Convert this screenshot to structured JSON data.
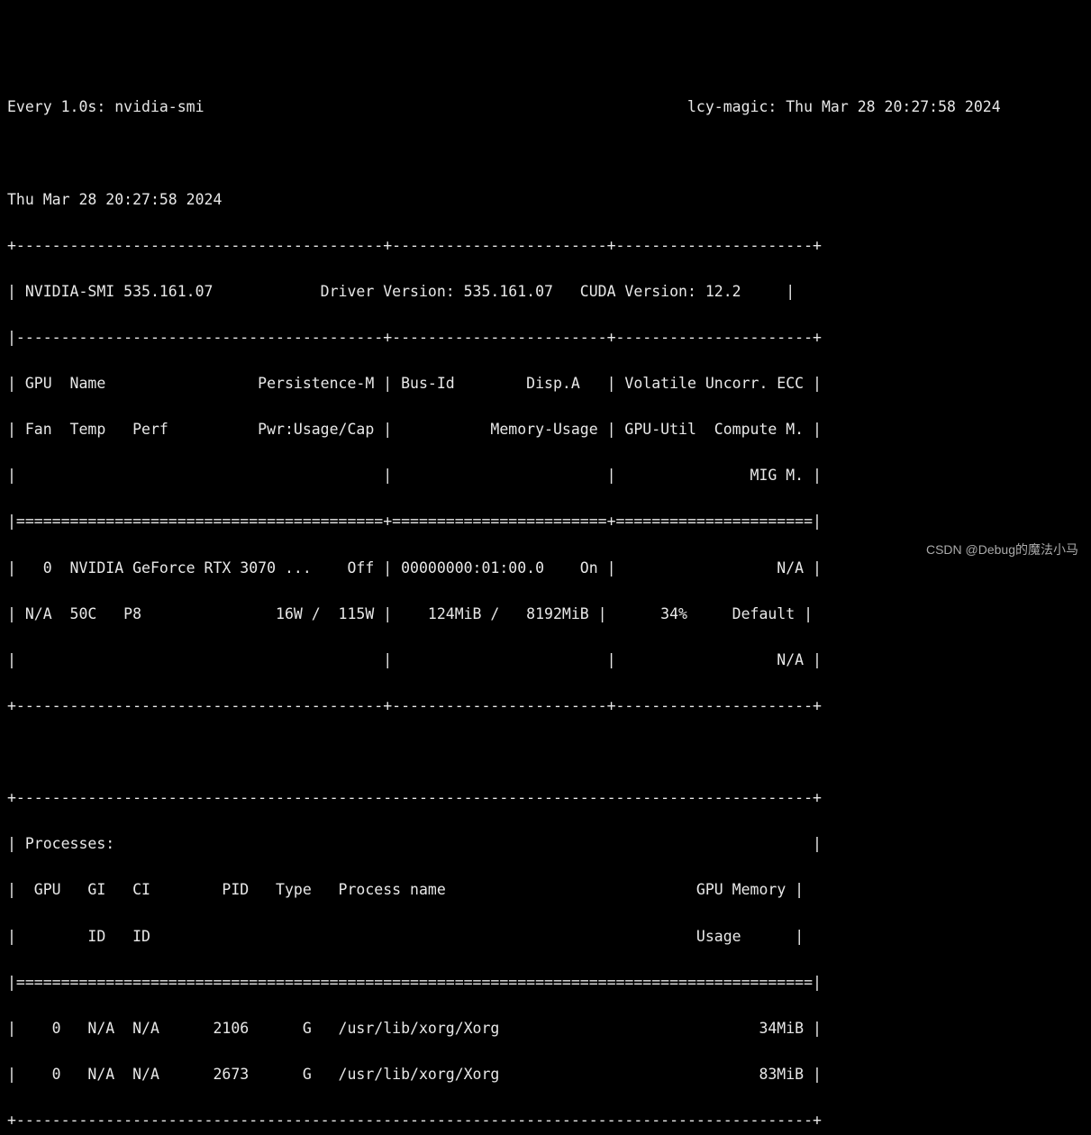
{
  "watch": {
    "interval_line": "Every 1.0s: nvidia-smi",
    "host_time": "lcy-magic: Thu Mar 28 20:27:58 2024"
  },
  "timestamp": "Thu Mar 28 20:27:58 2024",
  "smi": {
    "version": "535.161.07",
    "driver_version": "535.161.07",
    "cuda_version": "12.2"
  },
  "headers": {
    "col1_row1": "GPU  Name                 Persistence-M",
    "col1_row2": "Fan  Temp   Perf          Pwr:Usage/Cap",
    "col2_row1": "Bus-Id        Disp.A",
    "col2_row2": "Memory-Usage",
    "col3_row1": "Volatile Uncorr. ECC",
    "col3_row2": "GPU-Util  Compute M.",
    "col3_row3": "MIG M."
  },
  "gpu": {
    "index": "0",
    "name": "NVIDIA GeForce RTX 3070 ...",
    "persistence": "Off",
    "bus_id": "00000000:01:00.0",
    "disp_a": "On",
    "ecc": "N/A",
    "fan": "N/A",
    "temp": "50C",
    "perf": "P8",
    "pwr_usage": "16W",
    "pwr_cap": "115W",
    "mem_used": "124MiB",
    "mem_total": "8192MiB",
    "gpu_util": "34%",
    "compute_mode": "Default",
    "mig_mode": "N/A"
  },
  "processes": {
    "title": "Processes:",
    "header1": "  GPU   GI   CI        PID   Type   Process name                            GPU Memory",
    "header2": "        ID   ID                                                             Usage",
    "rows": [
      {
        "gpu": "0",
        "gi": "N/A",
        "ci": "N/A",
        "pid": "2106",
        "type": "G",
        "name": "/usr/lib/xorg/Xorg",
        "mem": "34MiB"
      },
      {
        "gpu": "0",
        "gi": "N/A",
        "ci": "N/A",
        "pid": "2673",
        "type": "G",
        "name": "/usr/lib/xorg/Xorg",
        "mem": "83MiB"
      }
    ]
  },
  "watermark": "CSDN @Debug的魔法小马",
  "_formatted": {
    "watch_line": "",
    "version_line": "",
    "hdr1": "",
    "hdr2": "",
    "hdr3": "",
    "gpu_line1": "",
    "gpu_line2": "",
    "gpu_line3": "",
    "proc_row_0": "",
    "proc_row_1": ""
  }
}
